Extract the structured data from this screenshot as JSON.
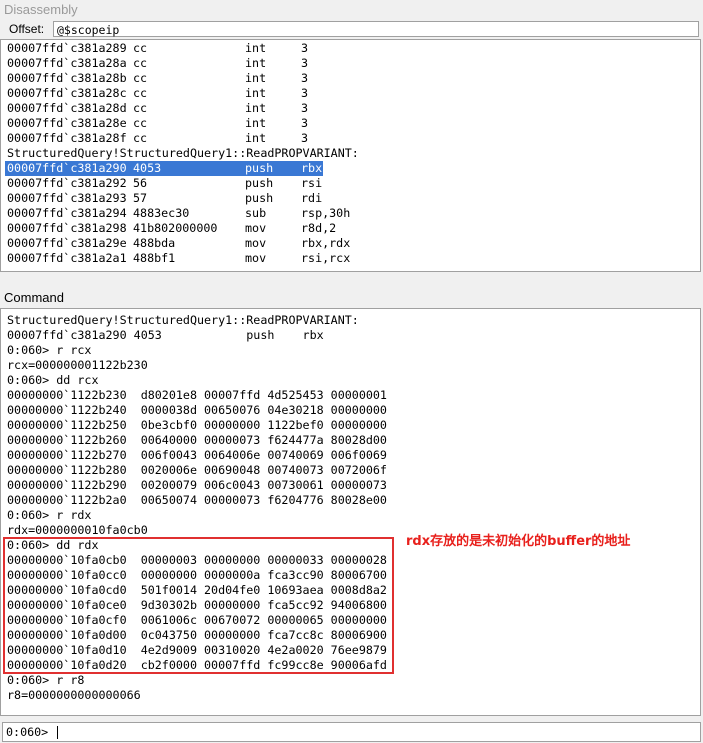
{
  "disassembly": {
    "title": "Disassembly",
    "offset_label": "Offset:",
    "offset_value": "@$scopeip",
    "lines": [
      {
        "addr": "00007ffd`c381a289",
        "bytes": "cc",
        "mnem": "int",
        "ops": "3"
      },
      {
        "addr": "00007ffd`c381a28a",
        "bytes": "cc",
        "mnem": "int",
        "ops": "3"
      },
      {
        "addr": "00007ffd`c381a28b",
        "bytes": "cc",
        "mnem": "int",
        "ops": "3"
      },
      {
        "addr": "00007ffd`c381a28c",
        "bytes": "cc",
        "mnem": "int",
        "ops": "3"
      },
      {
        "addr": "00007ffd`c381a28d",
        "bytes": "cc",
        "mnem": "int",
        "ops": "3"
      },
      {
        "addr": "00007ffd`c381a28e",
        "bytes": "cc",
        "mnem": "int",
        "ops": "3"
      },
      {
        "addr": "00007ffd`c381a28f",
        "bytes": "cc",
        "mnem": "int",
        "ops": "3"
      },
      {
        "addr": "StructuredQuery!StructuredQuery1::ReadPROPVARIANT:",
        "bytes": "",
        "mnem": "",
        "ops": ""
      },
      {
        "addr": "00007ffd`c381a290",
        "bytes": "4053",
        "mnem": "push",
        "ops": "rbx"
      },
      {
        "addr": "00007ffd`c381a292",
        "bytes": "56",
        "mnem": "push",
        "ops": "rsi"
      },
      {
        "addr": "00007ffd`c381a293",
        "bytes": "57",
        "mnem": "push",
        "ops": "rdi"
      },
      {
        "addr": "00007ffd`c381a294",
        "bytes": "4883ec30",
        "mnem": "sub",
        "ops": "rsp,30h"
      },
      {
        "addr": "00007ffd`c381a298",
        "bytes": "41b802000000",
        "mnem": "mov",
        "ops": "r8d,2"
      },
      {
        "addr": "00007ffd`c381a29e",
        "bytes": "488bda",
        "mnem": "mov",
        "ops": "rbx,rdx"
      },
      {
        "addr": "00007ffd`c381a2a1",
        "bytes": "488bf1",
        "mnem": "mov",
        "ops": "rsi,rcx"
      }
    ]
  },
  "command": {
    "title": "Command",
    "lines": [
      "StructuredQuery!StructuredQuery1::ReadPROPVARIANT:",
      "00007ffd`c381a290 4053            push    rbx",
      "0:060> r rcx",
      "rcx=000000001122b230",
      "0:060> dd rcx",
      "00000000`1122b230  d80201e8 00007ffd 4d525453 00000001",
      "00000000`1122b240  0000038d 00650076 04e30218 00000000",
      "00000000`1122b250  0be3cbf0 00000000 1122bef0 00000000",
      "00000000`1122b260  00640000 00000073 f624477a 80028d00",
      "00000000`1122b270  006f0043 0064006e 00740069 006f0069",
      "00000000`1122b280  0020006e 00690048 00740073 0072006f",
      "00000000`1122b290  00200079 006c0043 00730061 00000073",
      "00000000`1122b2a0  00650074 00000073 f6204776 80028e00",
      "0:060> r rdx",
      "rdx=0000000010fa0cb0",
      "0:060> dd rdx",
      "00000000`10fa0cb0  00000003 00000000 00000033 00000028",
      "00000000`10fa0cc0  00000000 0000000a fca3cc90 80006700",
      "00000000`10fa0cd0  501f0014 20d04fe0 10693aea 0008d8a2",
      "00000000`10fa0ce0  9d30302b 00000000 fca5cc92 94006800",
      "00000000`10fa0cf0  0061006c 00670072 00000065 00000000",
      "00000000`10fa0d00  0c043750 00000000 fca7cc8c 80006900",
      "00000000`10fa0d10  4e2d9009 00310020 4e2a0020 76ee9879",
      "00000000`10fa0d20  cb2f0000 00007ffd fc99cc8e 90006afd",
      "0:060> r r8",
      "r8=0000000000000066"
    ],
    "annotation": "rdx存放的是未初始化的buffer的地址",
    "prompt": "0:060>"
  },
  "colors": {
    "highlight": "#3a78d4",
    "annotation": "#e8201c",
    "annotation_box": "#e03030"
  }
}
